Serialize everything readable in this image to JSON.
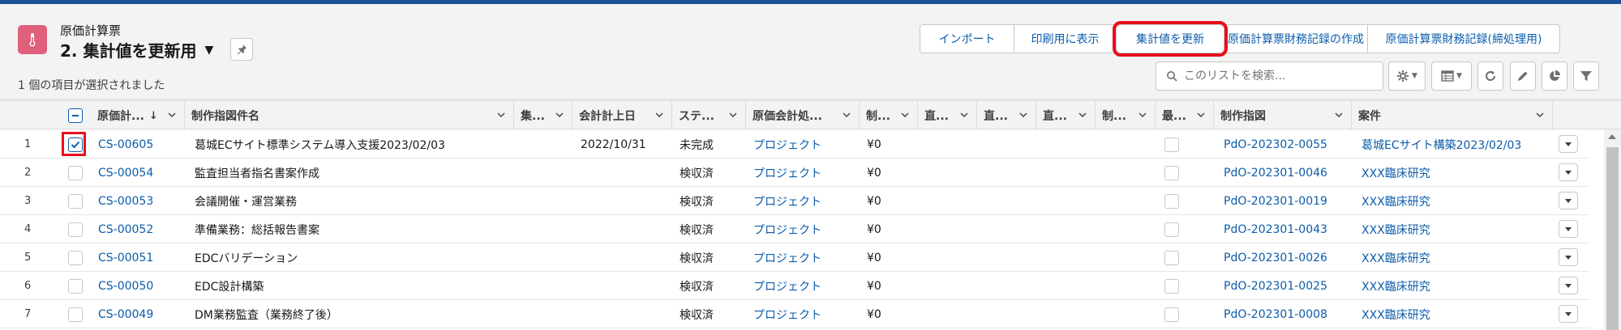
{
  "header": {
    "object_name": "原価計算票",
    "list_view_title": "2. 集計値を更新用",
    "selected_info": "1 個の項目が選択されました",
    "object_icon": "thermometer-icon",
    "icon_color": "#e0607c"
  },
  "actions": {
    "import_label": "インポート",
    "print_label": "印刷用に表示",
    "update_totals_label": "集計値を更新",
    "create_financial_label": "原価計算票財務記録の作成",
    "create_financial_closing_label": "原価計算票財務記録(締処理用)"
  },
  "search": {
    "placeholder": "このリストを検索..."
  },
  "table": {
    "columns": [
      {
        "label": "原価計...",
        "sorted": "desc"
      },
      {
        "label": "制作指図件名"
      },
      {
        "label": "集..."
      },
      {
        "label": "会計計上日"
      },
      {
        "label": "ステ..."
      },
      {
        "label": "原価会計処..."
      },
      {
        "label": "制..."
      },
      {
        "label": "直..."
      },
      {
        "label": "直..."
      },
      {
        "label": "直..."
      },
      {
        "label": "制..."
      },
      {
        "label": "最..."
      },
      {
        "label": "制作指図"
      },
      {
        "label": "案件"
      }
    ],
    "rows": [
      {
        "num": "1",
        "checked": true,
        "id": "CS-00605",
        "name": "葛城ECサイト標準システム導入支援2023/02/03",
        "date": "2022/10/31",
        "status": "未完成",
        "process": "プロジェクト",
        "amount": "¥0",
        "order": "PdO-202302-0055",
        "project": "葛城ECサイト構築2023/02/03"
      },
      {
        "num": "2",
        "checked": false,
        "id": "CS-00054",
        "name": "監査担当者指名書案作成",
        "date": "",
        "status": "検収済",
        "process": "プロジェクト",
        "amount": "¥0",
        "order": "PdO-202301-0046",
        "project": "XXX臨床研究"
      },
      {
        "num": "3",
        "checked": false,
        "id": "CS-00053",
        "name": "会議開催・運営業務",
        "date": "",
        "status": "検収済",
        "process": "プロジェクト",
        "amount": "¥0",
        "order": "PdO-202301-0019",
        "project": "XXX臨床研究"
      },
      {
        "num": "4",
        "checked": false,
        "id": "CS-00052",
        "name": "準備業務：総括報告書案",
        "date": "",
        "status": "検収済",
        "process": "プロジェクト",
        "amount": "¥0",
        "order": "PdO-202301-0043",
        "project": "XXX臨床研究"
      },
      {
        "num": "5",
        "checked": false,
        "id": "CS-00051",
        "name": "EDCバリデーション",
        "date": "",
        "status": "検収済",
        "process": "プロジェクト",
        "amount": "¥0",
        "order": "PdO-202301-0026",
        "project": "XXX臨床研究"
      },
      {
        "num": "6",
        "checked": false,
        "id": "CS-00050",
        "name": "EDC設計構築",
        "date": "",
        "status": "検収済",
        "process": "プロジェクト",
        "amount": "¥0",
        "order": "PdO-202301-0025",
        "project": "XXX臨床研究"
      },
      {
        "num": "7",
        "checked": false,
        "id": "CS-00049",
        "name": "DM業務監査（業務終了後）",
        "date": "",
        "status": "検収済",
        "process": "プロジェクト",
        "amount": "¥0",
        "order": "PdO-202301-0008",
        "project": "XXX臨床研究"
      }
    ]
  },
  "colors": {
    "link": "#0b5cab",
    "highlight": "#e8101b",
    "accent": "#1b5297"
  }
}
